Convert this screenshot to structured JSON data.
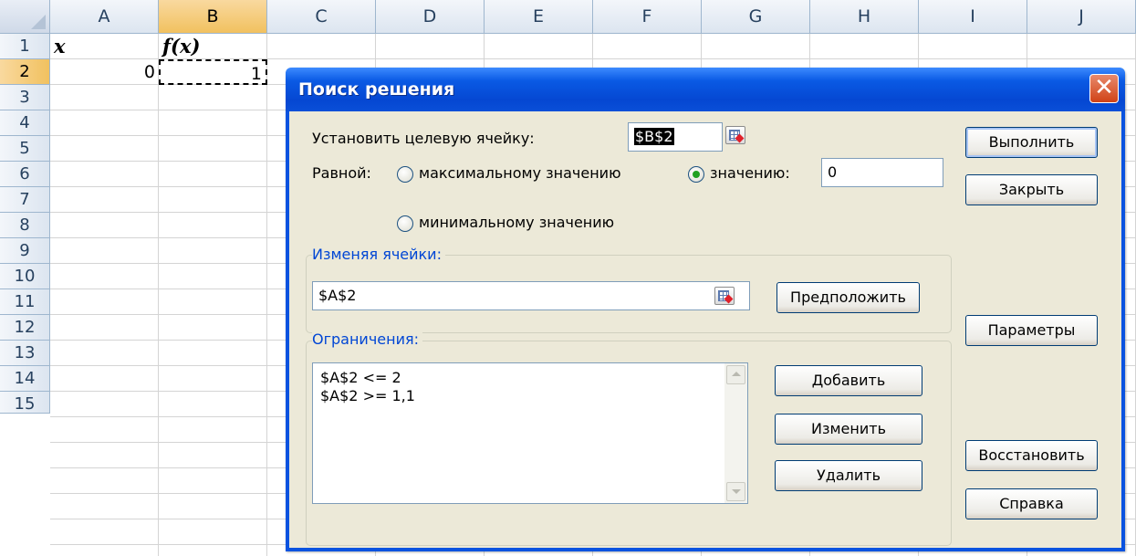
{
  "sheet": {
    "columns": [
      "A",
      "B",
      "C",
      "D",
      "E",
      "F",
      "G",
      "H",
      "I",
      "J"
    ],
    "rows": [
      "1",
      "2",
      "3",
      "4",
      "5",
      "6",
      "7",
      "8",
      "9",
      "10",
      "11",
      "12",
      "13",
      "14",
      "15"
    ],
    "cells": {
      "A1": "x",
      "B1": "f(x)",
      "A2": "0",
      "B2": "1"
    }
  },
  "dialog": {
    "title": "Поиск решения",
    "target_label": "Установить целевую ячейку:",
    "target_value": "$B$2",
    "equal_label": "Равной:",
    "opt_max": "максимальному значению",
    "opt_value": "значению:",
    "value_input": "0",
    "opt_min": "минимальному значению",
    "selected_option": "value",
    "changing_label": "Изменяя ячейки:",
    "changing_value": "$A$2",
    "constraints_label": "Ограничения:",
    "constraints": [
      "$A$2 <= 2",
      "$A$2 >= 1,1"
    ],
    "buttons": {
      "guess": "Предположить",
      "add": "Добавить",
      "change": "Изменить",
      "delete": "Удалить",
      "solve": "Выполнить",
      "close": "Закрыть",
      "options": "Параметры",
      "reset": "Восстановить",
      "help": "Справка"
    }
  }
}
